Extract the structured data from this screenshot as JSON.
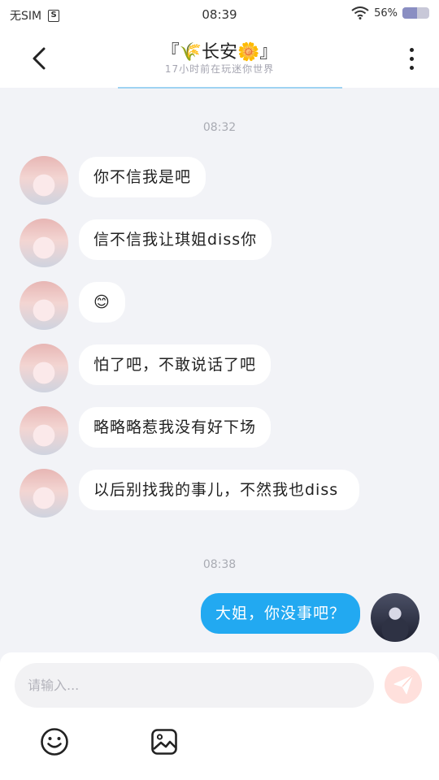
{
  "status_bar": {
    "carrier": "无SIM",
    "sim_icon_label": "S",
    "time": "08:39",
    "battery": "56%",
    "battery_level": 0.56
  },
  "header": {
    "title": "『🌾长安🌼』",
    "subtitle": "17小时前在玩迷你世界"
  },
  "messages": [
    {
      "time_label": "08:32"
    },
    {
      "sender": "other",
      "text": "你不信我是吧"
    },
    {
      "sender": "other",
      "text": "信不信我让琪姐diss你"
    },
    {
      "sender": "other",
      "text": "😊"
    },
    {
      "sender": "other",
      "text": "怕了吧，不敢说话了吧"
    },
    {
      "sender": "other",
      "text": "略略略惹我没有好下场"
    },
    {
      "sender": "other",
      "text": "以后别找我的事儿，不然我也diss"
    },
    {
      "time_label": "08:38"
    },
    {
      "sender": "me",
      "text": "大姐，你没事吧？"
    }
  ],
  "input": {
    "placeholder": "请输入..."
  },
  "icons": {
    "back": "back-arrow-icon",
    "more": "more-vertical-icon",
    "wifi": "wifi-icon",
    "send": "send-icon",
    "emoji": "emoji-icon",
    "image": "image-icon"
  },
  "colors": {
    "my_bubble": "#22a9f1",
    "background": "#f2f3f7",
    "send_button": "#ffe0dc"
  }
}
